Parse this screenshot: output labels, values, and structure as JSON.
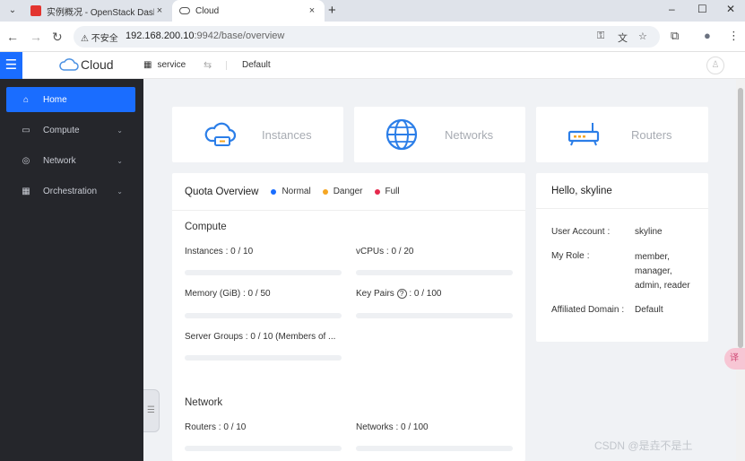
{
  "browser": {
    "tabs": [
      {
        "title": "实例概况 - OpenStack Dashboa",
        "close": "×"
      },
      {
        "title": "Cloud",
        "close": "×"
      }
    ],
    "tab_menu": "⌄",
    "new_tab": "+",
    "window_controls": {
      "minimize": "–",
      "maximize": "☐",
      "close": "✕"
    },
    "nav": {
      "back": "←",
      "forward": "→",
      "reload": "↻"
    },
    "security_label": "⚠ 不安全",
    "url_host": "192.168.200.10",
    "url_rest": ":9942/base/overview",
    "omnibox_icons": {
      "key": "⚿",
      "translate": "文",
      "star": "☆"
    },
    "toolbar_icons": {
      "extensions": "⧉",
      "profile": "●",
      "menu": "⋮"
    }
  },
  "header": {
    "brand": "Cloud",
    "project_icon": "▦",
    "project": "service",
    "switch_icon": "⇆",
    "domain": "Default",
    "avatar_icon": "♙",
    "menu_icon": "☰"
  },
  "sidebar": {
    "items": [
      {
        "label": "Home",
        "icon": "⌂",
        "chevron": ""
      },
      {
        "label": "Compute",
        "icon": "▭",
        "chevron": "⌄"
      },
      {
        "label": "Network",
        "icon": "◎",
        "chevron": "⌄"
      },
      {
        "label": "Orchestration",
        "icon": "▦",
        "chevron": "⌄"
      }
    ],
    "collapse_icon": "☰"
  },
  "summary": [
    {
      "label": "Instances",
      "icon": "cloud-instance-icon"
    },
    {
      "label": "Networks",
      "icon": "globe-icon"
    },
    {
      "label": "Routers",
      "icon": "router-icon"
    }
  ],
  "quota": {
    "title": "Quota Overview",
    "legend": [
      {
        "label": "Normal",
        "color": "#1a6dff"
      },
      {
        "label": "Danger",
        "color": "#f5a623"
      },
      {
        "label": "Full",
        "color": "#e5294c"
      }
    ],
    "compute_title": "Compute",
    "compute": [
      {
        "label": "Instances : 0 / 10",
        "used": 0,
        "total": 10
      },
      {
        "label": "vCPUs : 0 / 20",
        "used": 0,
        "total": 20
      },
      {
        "label": "Memory (GiB) : 0 / 50",
        "used": 0,
        "total": 50
      },
      {
        "label_a": "Key Pairs",
        "help": "?",
        "label_b": " : 0 / 100",
        "used": 0,
        "total": 100
      },
      {
        "label": "Server Groups : 0 / 10 (Members of ...",
        "used": 0,
        "total": 10
      }
    ],
    "network_title": "Network",
    "network": [
      {
        "label": "Routers : 0 / 10",
        "used": 0,
        "total": 10
      },
      {
        "label": "Networks : 0 / 100",
        "used": 0,
        "total": 100
      }
    ]
  },
  "user": {
    "greeting": "Hello, skyline",
    "account_label": "User Account",
    "account_value": "skyline",
    "role_label": "My Role",
    "roles": [
      "member,",
      "manager,",
      "admin, reader"
    ],
    "domain_label": "Affiliated Domain",
    "domain_value": "Default",
    "colon": ":"
  },
  "float_button": "译",
  "watermark": "CSDN @是垚不是土",
  "colors": {
    "primary": "#1a6dff",
    "sidebar_bg": "#25262b",
    "page_bg": "#f0f2f5"
  }
}
